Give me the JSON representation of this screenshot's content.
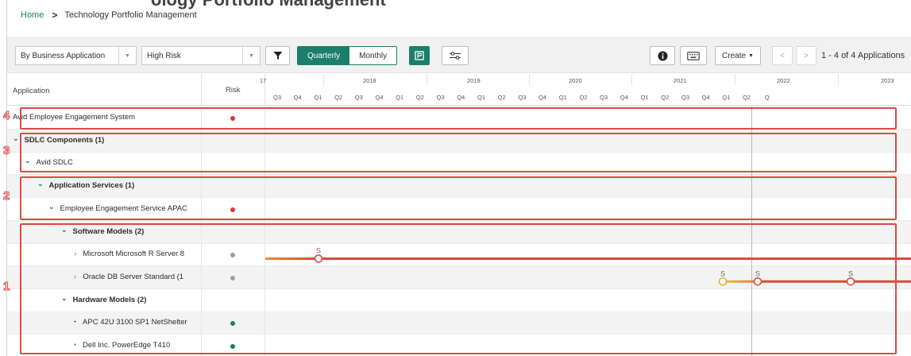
{
  "breadcrumb": {
    "home": "Home",
    "current": "Technology Portfolio Management"
  },
  "toolbar": {
    "group_by": "By Business Application",
    "risk_filter": "High Risk",
    "quarterly": "Quarterly",
    "monthly": "Monthly",
    "create": "Create",
    "pager": "1 - 4 of 4 Applications"
  },
  "grid": {
    "col_application": "Application",
    "col_risk": "Risk",
    "years": [
      "17",
      "2018",
      "2019",
      "2020",
      "2021",
      "2022",
      "2023"
    ],
    "quarters": [
      "Q3",
      "Q4",
      "Q1",
      "Q2",
      "Q3",
      "Q4",
      "Q1",
      "Q2",
      "Q3",
      "Q4",
      "Q1",
      "Q2",
      "Q3",
      "Q4",
      "Q1",
      "Q2",
      "Q3",
      "Q4",
      "Q1",
      "Q2",
      "Q3",
      "Q4",
      "Q1",
      "Q2",
      "Q"
    ]
  },
  "rows": [
    {
      "label": "Avid Employee Engagement System",
      "level": 0,
      "risk": "red"
    },
    {
      "label": "SDLC Components (1)",
      "level": 0,
      "bold": true,
      "risk": ""
    },
    {
      "label": "Avid SDLC",
      "level": 1,
      "risk": ""
    },
    {
      "label": "Application Services (1)",
      "level": 2,
      "bold": true,
      "risk": ""
    },
    {
      "label": "Employee Engagement Service APAC",
      "level": 3,
      "risk": "red"
    },
    {
      "label": "Software Models (2)",
      "level": 4,
      "bold": true,
      "risk": ""
    },
    {
      "label": "Microsoft Microsoft R Server 8",
      "level": 5,
      "risk": "grey"
    },
    {
      "label": "Oracle DB Server Standard (1",
      "level": 5,
      "risk": "grey"
    },
    {
      "label": "Hardware Models (2)",
      "level": 4,
      "bold": true,
      "risk": ""
    },
    {
      "label": "APC 42U 3100 SP1 NetShelter",
      "level": 5,
      "risk": "green"
    },
    {
      "label": "Dell Inc. PowerEdge T410",
      "level": 5,
      "risk": "green"
    }
  ],
  "milestone_label": "S",
  "annotations": [
    "4",
    "3",
    "2",
    "1"
  ],
  "colors": {
    "accent": "#1b7f6b",
    "risk_high": "#d63a34",
    "risk_medium": "#9e9e9e",
    "risk_low": "#1e7d5e",
    "annotation": "#e04848",
    "lifecycle": "#d94a3a"
  }
}
